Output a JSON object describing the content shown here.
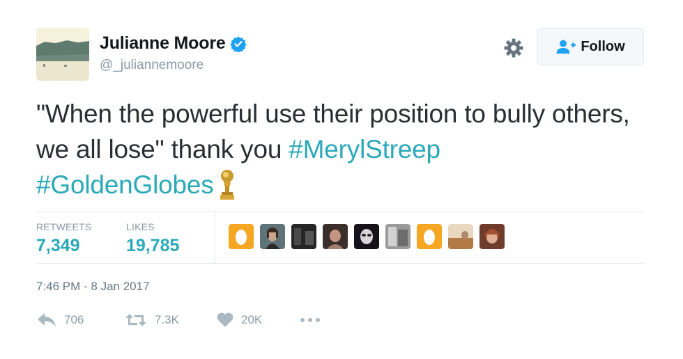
{
  "user": {
    "display_name": "Julianne Moore",
    "handle": "@_juliannemoore",
    "verified": true
  },
  "header": {
    "follow_label": "Follow"
  },
  "tweet": {
    "text_main": "\"When the powerful use their position to bully others, we all lose\" thank you ",
    "hashtag_1": "#MerylStreep",
    "hashtag_2": "#GoldenGlobes",
    "emoji": "golden-globe-trophy"
  },
  "stats": {
    "retweets_label": "RETWEETS",
    "retweets_value": "7,349",
    "likes_label": "LIKES",
    "likes_value": "19,785"
  },
  "likers": [
    {
      "kind": "default-egg",
      "color": "#f5a623"
    },
    {
      "kind": "photo",
      "color": "#4b5a5f"
    },
    {
      "kind": "photo",
      "color": "#2f2f2f"
    },
    {
      "kind": "photo",
      "color": "#7a5c4f"
    },
    {
      "kind": "photo",
      "color": "#1f1b1f"
    },
    {
      "kind": "photo",
      "color": "#8d8d8d"
    },
    {
      "kind": "default-egg",
      "color": "#f5a623"
    },
    {
      "kind": "photo",
      "color": "#b8854f"
    },
    {
      "kind": "photo",
      "color": "#a0603f"
    }
  ],
  "timestamp": "7:46 PM - 8 Jan 2017",
  "actions": {
    "reply_count": "706",
    "retweet_count": "7.3K",
    "like_count": "20K"
  },
  "colors": {
    "accent": "#2ba9b8",
    "verified": "#1da1f2",
    "muted": "#8899a6"
  }
}
